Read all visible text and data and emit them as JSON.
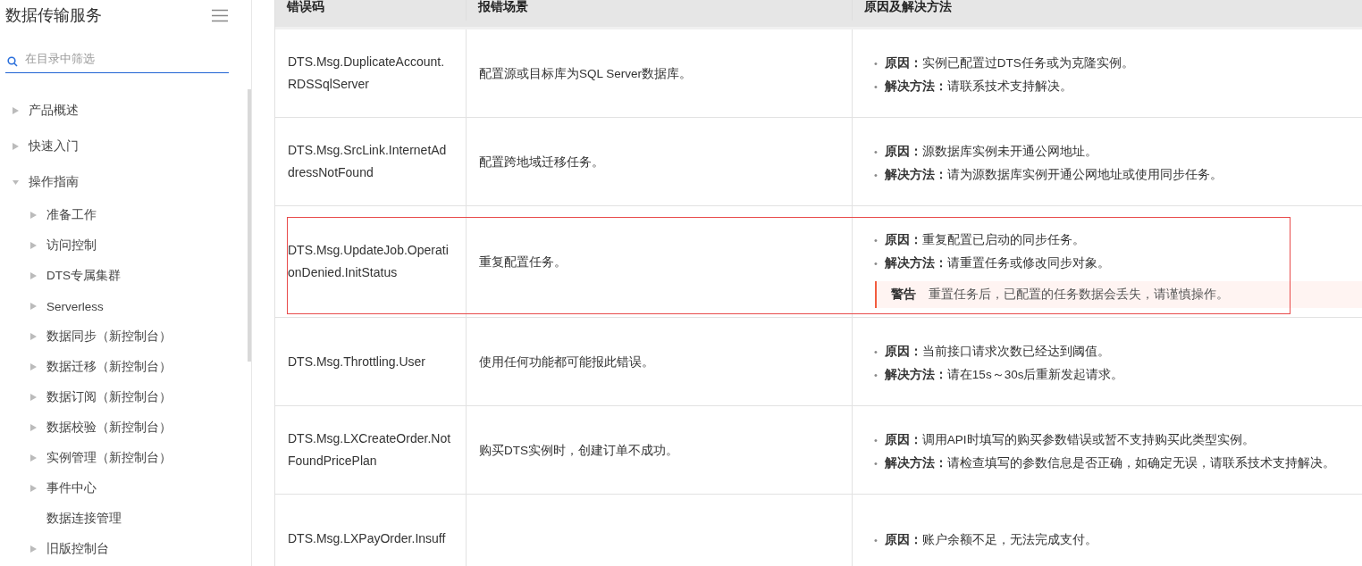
{
  "sidebar": {
    "title": "数据传输服务",
    "search": {
      "placeholder": "在目录中筛选"
    },
    "tree": [
      {
        "label": "产品概述",
        "kind": "folder",
        "expanded": false
      },
      {
        "label": "快速入门",
        "kind": "folder",
        "expanded": false
      },
      {
        "label": "操作指南",
        "kind": "folder",
        "expanded": true,
        "children": [
          {
            "label": "准备工作",
            "kind": "folder",
            "expanded": false
          },
          {
            "label": "访问控制",
            "kind": "folder",
            "expanded": false
          },
          {
            "label": "DTS专属集群",
            "kind": "folder",
            "expanded": false
          },
          {
            "label": "Serverless",
            "kind": "folder",
            "expanded": false
          },
          {
            "label": "数据同步（新控制台）",
            "kind": "folder",
            "expanded": false
          },
          {
            "label": "数据迁移（新控制台）",
            "kind": "folder",
            "expanded": false
          },
          {
            "label": "数据订阅（新控制台）",
            "kind": "folder",
            "expanded": false
          },
          {
            "label": "数据校验（新控制台）",
            "kind": "folder",
            "expanded": false
          },
          {
            "label": "实例管理（新控制台）",
            "kind": "folder",
            "expanded": false
          },
          {
            "label": "事件中心",
            "kind": "folder",
            "expanded": false
          },
          {
            "label": "数据连接管理",
            "kind": "leaf"
          },
          {
            "label": "旧版控制台",
            "kind": "folder",
            "expanded": false
          }
        ]
      }
    ]
  },
  "table": {
    "bullet": "•",
    "columns": [
      "错误码",
      "报错场景",
      "原因及解决方法"
    ],
    "rows": [
      {
        "code": "DTS.Msg.DuplicateAccount.RDSSqlServer",
        "scene": "配置源或目标库为SQL Server数据库。",
        "highlighted": false,
        "items": [
          {
            "label": "原因：",
            "text": "实例已配置过DTS任务或为克隆实例。"
          },
          {
            "label": "解决方法：",
            "text": "请联系技术支持解决。"
          }
        ]
      },
      {
        "code": "DTS.Msg.SrcLink.InternetAddressNotFound",
        "scene": "配置跨地域迁移任务。",
        "highlighted": false,
        "items": [
          {
            "label": "原因：",
            "text": "源数据库实例未开通公网地址。"
          },
          {
            "label": "解决方法：",
            "text": "请为源数据库实例开通公网地址或使用同步任务。"
          }
        ]
      },
      {
        "code": "DTS.Msg.UpdateJob.OperationDenied.InitStatus",
        "scene": "重复配置任务。",
        "highlighted": true,
        "items": [
          {
            "label": "原因：",
            "text": "重复配置已启动的同步任务。"
          },
          {
            "label": "解决方法：",
            "text": "请重置任务或修改同步对象。"
          }
        ],
        "warning": {
          "label": "警告",
          "text": "重置任务后，已配置的任务数据会丢失，请谨慎操作。"
        }
      },
      {
        "code": "DTS.Msg.Throttling.User",
        "scene": "使用任何功能都可能报此错误。",
        "highlighted": false,
        "items": [
          {
            "label": "原因：",
            "text": "当前接口请求次数已经达到阈值。"
          },
          {
            "label": "解决方法：",
            "text": "请在15s～30s后重新发起请求。"
          }
        ]
      },
      {
        "code": "DTS.Msg.LXCreateOrder.NotFoundPricePlan",
        "scene": "购买DTS实例时，创建订单不成功。",
        "highlighted": false,
        "items": [
          {
            "label": "原因：",
            "text": "调用API时填写的购买参数错误或暂不支持购买此类型实例。"
          },
          {
            "label": "解决方法：",
            "text": "请检查填写的参数信息是否正确，如确定无误，请联系技术支持解决。"
          }
        ]
      },
      {
        "code": "DTS.Msg.LXPayOrder.Insuff",
        "highlighted": false,
        "items": [
          {
            "label": "原因：",
            "text": "账户余额不足，无法完成支付。"
          }
        ]
      }
    ]
  }
}
